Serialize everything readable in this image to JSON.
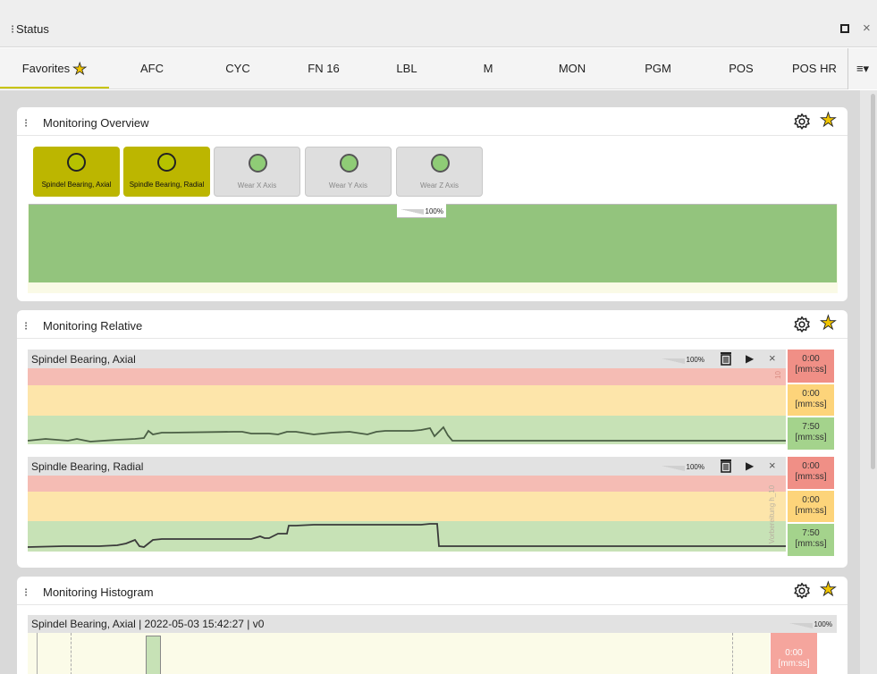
{
  "window": {
    "title": "Status"
  },
  "tabs": [
    {
      "label": "Favorites",
      "active": true
    },
    {
      "label": "AFC"
    },
    {
      "label": "CYC"
    },
    {
      "label": "FN 16"
    },
    {
      "label": "LBL"
    },
    {
      "label": "M"
    },
    {
      "label": "MON"
    },
    {
      "label": "PGM"
    },
    {
      "label": "POS"
    },
    {
      "label": "POS HR"
    }
  ],
  "tab_menu": "≡▾",
  "overview": {
    "title": "Monitoring Overview",
    "buttons": [
      {
        "label": "Spindel Bearing, Axial",
        "active": true
      },
      {
        "label": "Spindle Bearing, Radial",
        "active": true
      },
      {
        "label": "Wear X Axis",
        "active": false
      },
      {
        "label": "Wear Y Axis",
        "active": false
      },
      {
        "label": "Wear Z Axis",
        "active": false
      }
    ],
    "zoom": "100%"
  },
  "relative": {
    "title": "Monitoring Relative",
    "strips": [
      {
        "name": "Spindel Bearing, Axial",
        "zoom": "100%",
        "side_label": "10",
        "timers": [
          "0:00\n[mm:ss]",
          "0:00\n[mm:ss]",
          "7:50\n[mm:ss]"
        ]
      },
      {
        "name": "Spindle Bearing, Radial",
        "zoom": "100%",
        "side_label": "Vorbereitung h_10",
        "timers": [
          "0:00\n[mm:ss]",
          "0:00\n[mm:ss]",
          "7:50\n[mm:ss]"
        ]
      }
    ]
  },
  "histogram": {
    "title": "Monitoring Histogram",
    "header": "Spindel Bearing, Axial | 2022-05-03 15:42:27 | v0",
    "zoom": "100%",
    "timer": "0:00\n[mm:ss]"
  },
  "colors": {
    "accent": "#bcb600",
    "favorite_star": "#f0c400",
    "limit_red": "#f5bcb4",
    "limit_yellow": "#fde5aa",
    "limit_green": "#c7e2b6",
    "overview_green": "#93c47d"
  },
  "icons": [
    "kebab-icon",
    "maximize-icon",
    "close-icon",
    "star-icon",
    "gear-icon",
    "trash-icon",
    "play-icon",
    "menu-icon"
  ]
}
